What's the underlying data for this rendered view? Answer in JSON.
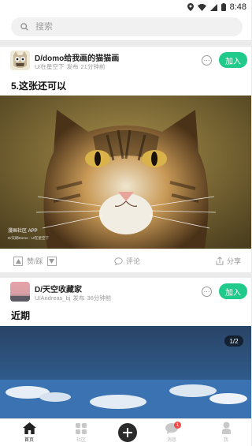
{
  "status_bar": {
    "time": "8:48"
  },
  "search": {
    "placeholder": "搜索"
  },
  "posts": [
    {
      "group": "D/domo给我画的猫猫画",
      "author": "U/在星空下",
      "action": "发布",
      "time": "21分钟前",
      "title": "5.这张还可以",
      "join_label": "加入",
      "watermark_brand": "漫画社区 APP",
      "watermark_sub": "D/天刷Domo · U/在星空下",
      "vote_label": "赞/踩",
      "comment_label": "评论",
      "share_label": "分享"
    },
    {
      "group": "D/天空收藏家",
      "author": "U/Andreas_bj",
      "action": "发布",
      "time": "36分钟前",
      "title": "近期",
      "join_label": "加入",
      "page_indicator": "1/2"
    }
  ],
  "tab_bar": {
    "items": [
      {
        "label": "首页",
        "icon": "home-icon",
        "active": true
      },
      {
        "label": "社区",
        "icon": "grid-icon"
      },
      {
        "label": "",
        "icon": "plus-icon"
      },
      {
        "label": "消息",
        "icon": "message-icon",
        "badge": "1"
      },
      {
        "label": "我",
        "icon": "person-icon"
      }
    ]
  },
  "colors": {
    "accent": "#1fca8a",
    "badge": "#f04a4a"
  }
}
